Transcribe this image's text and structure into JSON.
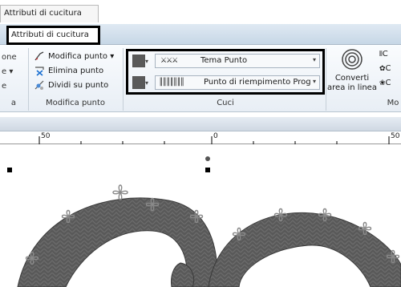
{
  "context_tab": {
    "label": "Attributi di cucitura"
  },
  "ribbon_tab": {
    "label": "Attributi di cucitura"
  },
  "left_partial": {
    "row1": "one",
    "row2": "e ▾",
    "row3": "e",
    "group": "a"
  },
  "modifica": {
    "items": [
      {
        "label": "Modifica punto ▾",
        "icon": "stitch-edit-icon"
      },
      {
        "label": "Elimina punto",
        "icon": "delete-stitch-icon"
      },
      {
        "label": "Dividi su punto",
        "icon": "split-stitch-icon"
      }
    ],
    "group_label": "Modifica punto"
  },
  "cuci": {
    "row1": {
      "pattern_glyph": "⚔⚔⚔",
      "label": "Tema Punto"
    },
    "row2": {
      "pattern_glyph": "║║║║║║║",
      "label": "Punto di riempimento Prog"
    },
    "group_label": "Cuci"
  },
  "converti": {
    "label": "Converti area in linea"
  },
  "right_partial": {
    "group": "Mo",
    "items": [
      "C",
      "C",
      "C"
    ]
  },
  "ruler": {
    "ticks": [
      "50",
      "0",
      "50"
    ]
  },
  "colors": {
    "swatch": "#5a5a5a",
    "outline": "#000000",
    "fill_dark": "#595959"
  }
}
